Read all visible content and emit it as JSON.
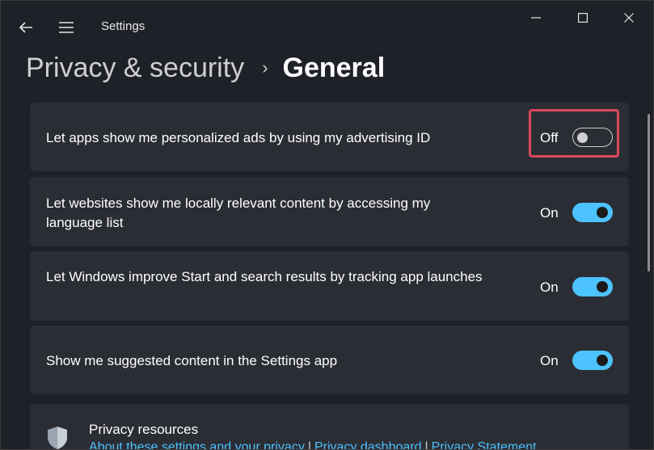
{
  "titlebar": {
    "app_title": "Settings",
    "icons": {
      "back": "back-arrow-icon",
      "menu": "hamburger-menu-icon",
      "minimize": "minimize-icon",
      "maximize": "maximize-icon",
      "close": "close-icon"
    }
  },
  "breadcrumb": {
    "parent": "Privacy & security",
    "separator": "›",
    "current": "General"
  },
  "settings": [
    {
      "label": "Let apps show me personalized ads by using my advertising ID",
      "state_label": "Off",
      "on": false
    },
    {
      "label": "Let websites show me locally relevant content by accessing my language list",
      "state_label": "On",
      "on": true
    },
    {
      "label": "Let Windows improve Start and search results by tracking app launches",
      "state_label": "On",
      "on": true
    },
    {
      "label": "Show me suggested content in the Settings app",
      "state_label": "On",
      "on": true
    }
  ],
  "resources": {
    "title": "Privacy resources",
    "links": [
      "About these settings and your privacy",
      "Privacy dashboard",
      "Privacy Statement"
    ],
    "icon": "shield-icon"
  },
  "colors": {
    "accent": "#4cc2ff",
    "highlight": "#d9485a",
    "card_bg": "#2b2d35",
    "window_bg": "#1f2128"
  }
}
